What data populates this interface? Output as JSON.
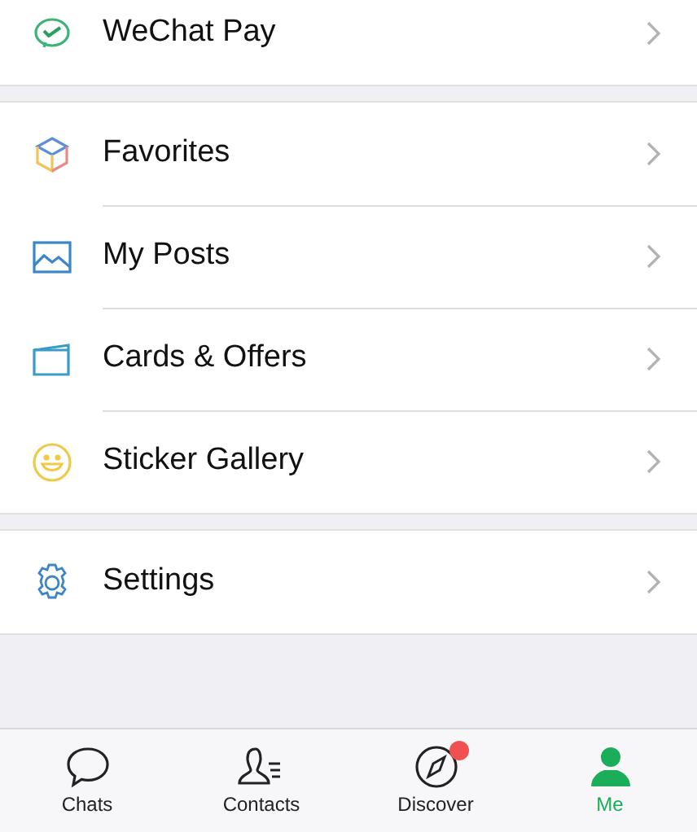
{
  "sections": [
    {
      "items": [
        {
          "label": "WeChat Pay",
          "kind": "pay"
        }
      ]
    },
    {
      "items": [
        {
          "label": "Favorites",
          "kind": "cube"
        },
        {
          "label": "My Posts",
          "kind": "image"
        },
        {
          "label": "Cards & Offers",
          "kind": "card"
        },
        {
          "label": "Sticker Gallery",
          "kind": "smile"
        }
      ]
    },
    {
      "items": [
        {
          "label": "Settings",
          "kind": "gear"
        }
      ]
    }
  ],
  "tab_bar": [
    {
      "label": "Chats",
      "kind": "chat",
      "selected": false,
      "dot": false
    },
    {
      "label": "Contacts",
      "kind": "contacts",
      "selected": false,
      "dot": false
    },
    {
      "label": "Discover",
      "kind": "compass",
      "selected": false,
      "dot": true
    },
    {
      "label": "Me",
      "kind": "person",
      "selected": true,
      "dot": false
    }
  ]
}
